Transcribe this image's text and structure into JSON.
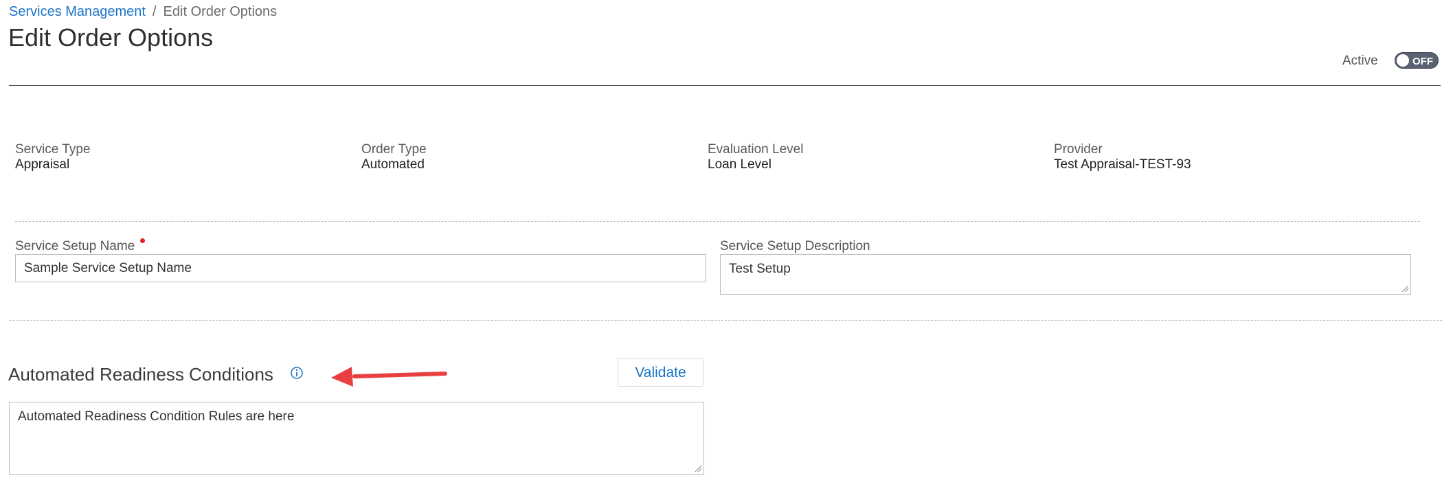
{
  "breadcrumb": {
    "parent": "Services Management",
    "separator": "/",
    "current": "Edit Order Options"
  },
  "page_title": "Edit Order Options",
  "active_toggle": {
    "label": "Active",
    "state": "OFF"
  },
  "summary": {
    "service_type": {
      "label": "Service Type",
      "value": "Appraisal"
    },
    "order_type": {
      "label": "Order Type",
      "value": "Automated"
    },
    "evaluation_level": {
      "label": "Evaluation Level",
      "value": "Loan Level"
    },
    "provider": {
      "label": "Provider",
      "value": "Test Appraisal-TEST-93"
    }
  },
  "service_setup": {
    "name_label": "Service Setup Name",
    "name_value": "Sample Service Setup Name",
    "description_label": "Service Setup Description",
    "description_value": "Test Setup"
  },
  "readiness": {
    "title": "Automated Readiness Conditions",
    "validate_label": "Validate",
    "rules_text": "Automated Readiness Condition Rules are here"
  },
  "colors": {
    "link": "#1a73c8",
    "required": "#e02424",
    "toggle_bg": "#5a6173",
    "annotation_arrow": "#e84040"
  },
  "icons": {
    "info": "info-circle-icon",
    "resize": "resize-grip-icon",
    "annotation": "annotation-arrow-icon"
  }
}
